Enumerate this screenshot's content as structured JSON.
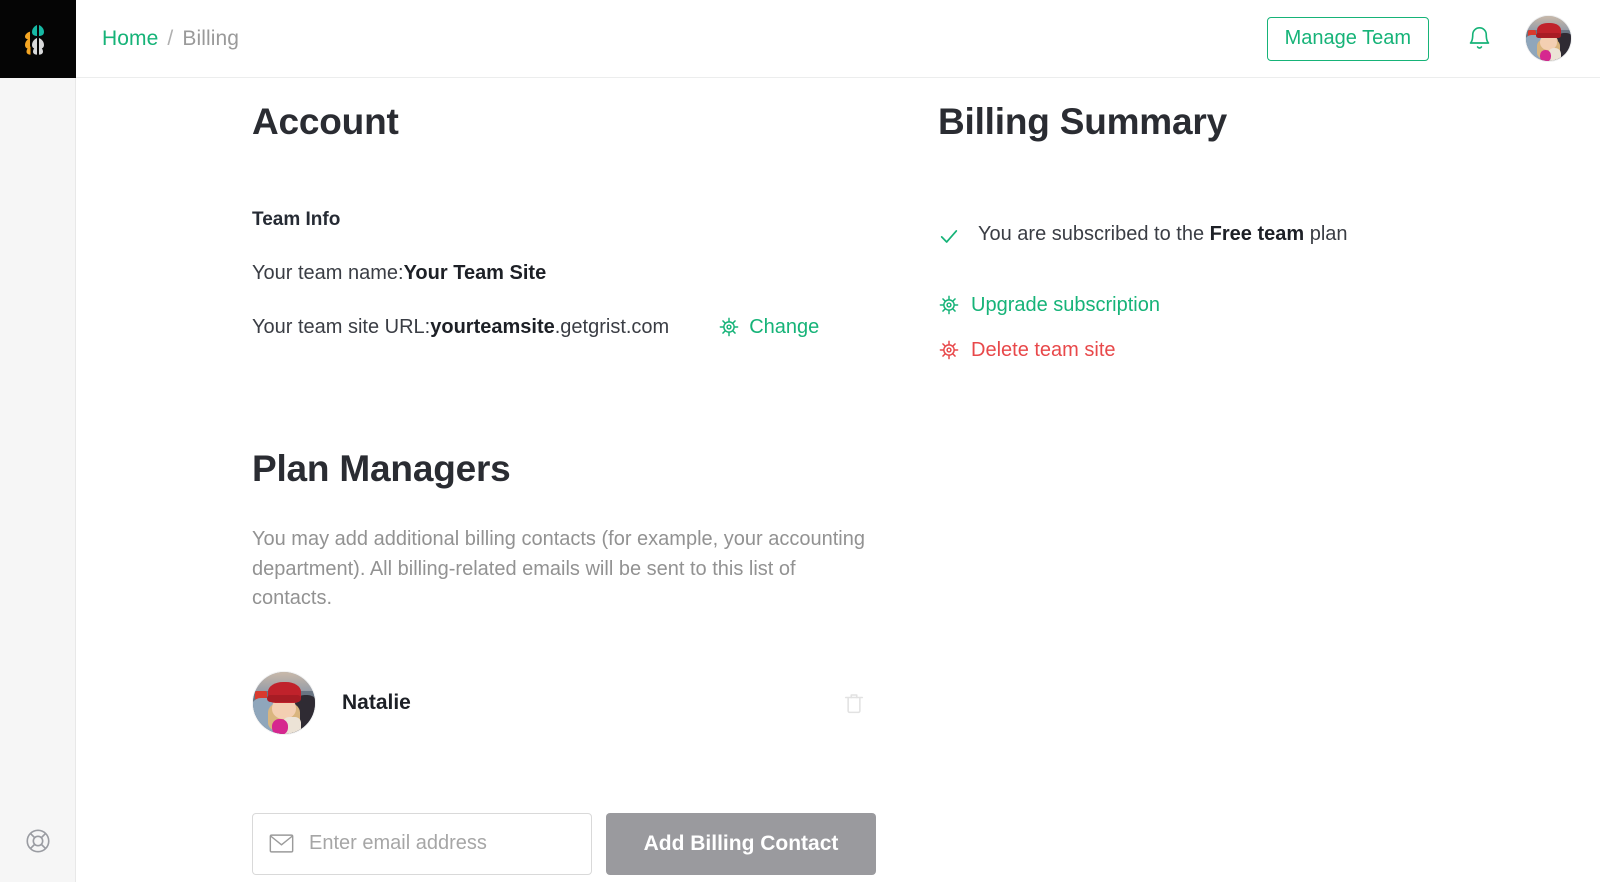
{
  "brand": {
    "logo_name": "grist-logo",
    "accent_green": "#16b378",
    "danger_red": "#e8484a",
    "muted_gray": "#929292"
  },
  "rail": {
    "support_icon": "life-ring-icon"
  },
  "header": {
    "breadcrumb": {
      "home": "Home",
      "separator": "/",
      "current": "Billing"
    },
    "manage_team_label": "Manage Team",
    "bell_icon": "notification-bell-icon",
    "avatar_name": "user-avatar"
  },
  "account": {
    "title": "Account",
    "team_info_heading": "Team Info",
    "team_name_label": "Your team name: ",
    "team_name_value": "Your Team Site",
    "team_url_label": "Your team site URL: ",
    "team_url_subdomain": "yourteamsite",
    "team_url_domain": ".getgrist.com",
    "change_label": "Change",
    "change_icon": "gear-icon"
  },
  "plan_managers": {
    "title": "Plan Managers",
    "description": "You may add additional billing contacts (for example, your accounting department). All billing-related emails will be sent to this list of contacts.",
    "contacts": [
      {
        "name": "Natalie",
        "avatar": "contact-avatar",
        "remove_icon": "trash-icon"
      }
    ],
    "email_placeholder": "Enter email address",
    "email_value": "",
    "email_icon": "envelope-icon",
    "add_button_label": "Add Billing Contact"
  },
  "billing_summary": {
    "title": "Billing Summary",
    "status_check_icon": "check-icon",
    "status_prefix": "You are subscribed to the ",
    "status_plan": "Free team",
    "status_suffix": " plan",
    "actions": [
      {
        "label": "Upgrade subscription",
        "icon": "gear-icon",
        "color": "#16b378",
        "kind": "upgrade"
      },
      {
        "label": "Delete team site",
        "icon": "gear-icon",
        "color": "#e8484a",
        "kind": "delete"
      }
    ]
  }
}
